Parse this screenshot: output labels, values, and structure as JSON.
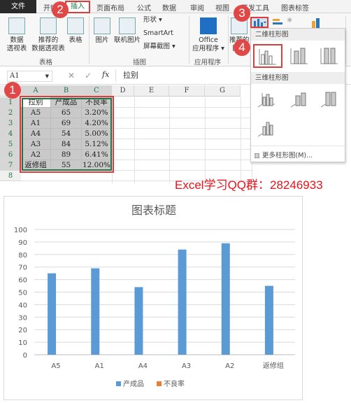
{
  "ribbon_tabs": [
    "文件",
    "开始",
    "插入",
    "页面布局",
    "公式",
    "数据",
    "审阅",
    "视图",
    "开发工具",
    "图表标签"
  ],
  "ribbon": {
    "groups": [
      {
        "label": "表格",
        "buttons": [
          "数据\n透视表",
          "推荐的\n数据透视表",
          "表格"
        ]
      },
      {
        "label": "插图",
        "buttons": [
          "图片",
          "联机图片"
        ],
        "small": [
          "形状 ▾",
          "SmartArt",
          "屏幕截图 ▾"
        ]
      },
      {
        "label": "应用程序",
        "buttons": [
          "Office\n应用程序 ▾"
        ]
      },
      {
        "label": "",
        "buttons": [
          "推荐的\n图表"
        ]
      }
    ]
  },
  "formula_bar": {
    "name_box": "A1",
    "content": "拉别",
    "cancel": "✕",
    "confirm": "✓",
    "fx": "fx"
  },
  "columns": [
    "A",
    "B",
    "C",
    "D",
    "E",
    "F",
    "G"
  ],
  "rows": [
    "1",
    "2",
    "3",
    "4",
    "5",
    "6",
    "7",
    "8"
  ],
  "table": {
    "headers": [
      "拉别",
      "产成品",
      "不良率"
    ],
    "rows": [
      [
        "A5",
        "65",
        "3.20%"
      ],
      [
        "A1",
        "69",
        "4.20%"
      ],
      [
        "A4",
        "54",
        "5.00%"
      ],
      [
        "A3",
        "84",
        "5.12%"
      ],
      [
        "A2",
        "89",
        "6.41%"
      ],
      [
        "返修组",
        "55",
        "12.00%"
      ]
    ]
  },
  "dropdown": {
    "section_2d": "二维柱形图",
    "section_3d": "三维柱形图",
    "more": "更多柱形图(M)..."
  },
  "badges": [
    "1",
    "2",
    "3",
    "4"
  ],
  "badge_color": "#e04848",
  "watermark": "Excel学习QQ群：28246933",
  "chart_data": {
    "type": "bar",
    "title": "图表标题",
    "categories": [
      "A5",
      "A1",
      "A4",
      "A3",
      "A2",
      "返修组"
    ],
    "series": [
      {
        "name": "产成品",
        "values": [
          65,
          69,
          54,
          84,
          89,
          55
        ],
        "color": "#5b9bd5"
      },
      {
        "name": "不良率",
        "values": [
          0.032,
          0.042,
          0.05,
          0.0512,
          0.0641,
          0.12
        ],
        "color": "#ed7d31"
      }
    ],
    "ylim": [
      0,
      100
    ],
    "yticks": [
      0,
      10,
      20,
      30,
      40,
      50,
      60,
      70,
      80,
      90,
      100
    ],
    "grid": true,
    "legend": "bottom"
  }
}
